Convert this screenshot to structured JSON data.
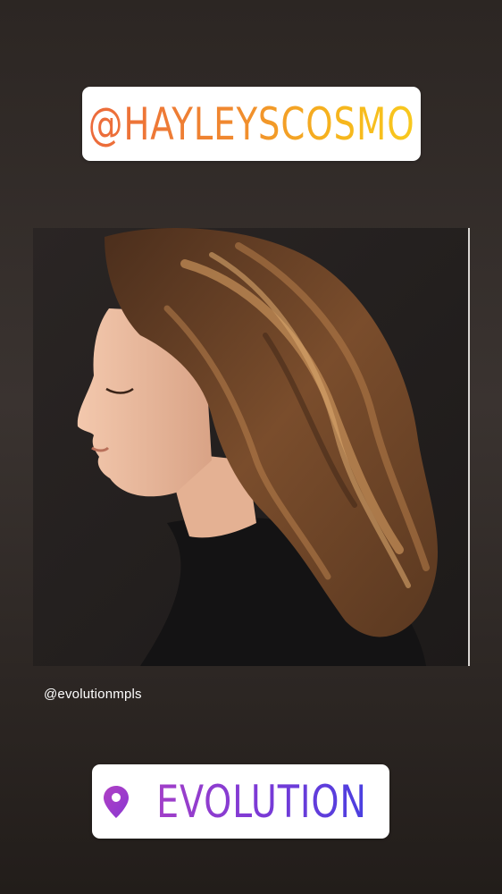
{
  "story": {
    "mention": "@HAYLEYSCOSMO",
    "photo_credit": "@evolutionmpls",
    "location": "EVOLUTION",
    "colors": {
      "mention_gradient": [
        "#ec6a3c",
        "#f8c91e"
      ],
      "location_gradient": [
        "#a23fc8",
        "#4a3fe0"
      ],
      "background": "#332c29"
    },
    "icons": {
      "location": "location-pin-icon"
    }
  }
}
